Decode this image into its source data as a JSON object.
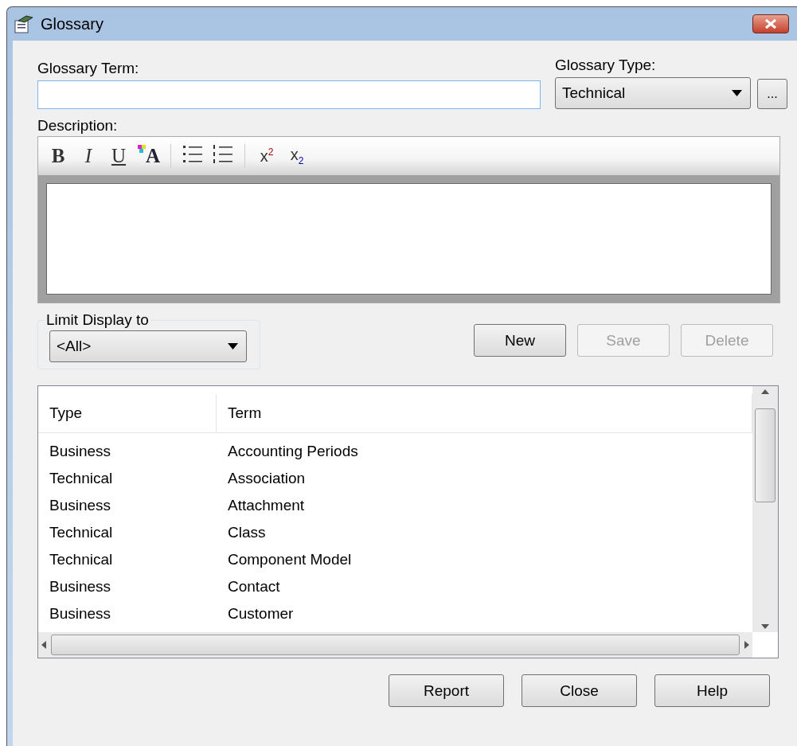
{
  "window": {
    "title": "Glossary"
  },
  "glossary_term": {
    "label": "Glossary Term:"
  },
  "glossary_type": {
    "label": "Glossary Type:",
    "value": "Technical",
    "browse": "..."
  },
  "description": {
    "label": "Description:",
    "toolbar": [
      {
        "kind": "bold",
        "label": "B"
      },
      {
        "kind": "italic",
        "label": "I"
      },
      {
        "kind": "underline",
        "label": "U"
      },
      {
        "kind": "font-color",
        "label": "A"
      },
      {
        "kind": "sep"
      },
      {
        "kind": "bullets"
      },
      {
        "kind": "numbers"
      },
      {
        "kind": "sep"
      },
      {
        "kind": "superscript",
        "label": "x$^{2}$"
      },
      {
        "kind": "subscript",
        "label": "x$_{2}$"
      }
    ]
  },
  "limit_display": {
    "label": "Limit Display to",
    "value": "<All>"
  },
  "actions": [
    {
      "label": "New",
      "disabled": false
    },
    {
      "label": "Save",
      "disabled": true
    },
    {
      "label": "Delete",
      "disabled": true
    }
  ],
  "table": {
    "columns": [
      "Type",
      "Term"
    ],
    "rows": [
      [
        "Business",
        "Accounting Periods"
      ],
      [
        "Technical",
        "Association"
      ],
      [
        "Business",
        "Attachment"
      ],
      [
        "Technical",
        "Class"
      ],
      [
        "Technical",
        "Component Model"
      ],
      [
        "Business",
        "Contact"
      ],
      [
        "Business",
        "Customer"
      ]
    ]
  },
  "buttons": [
    "Report",
    "Close",
    "Help"
  ]
}
